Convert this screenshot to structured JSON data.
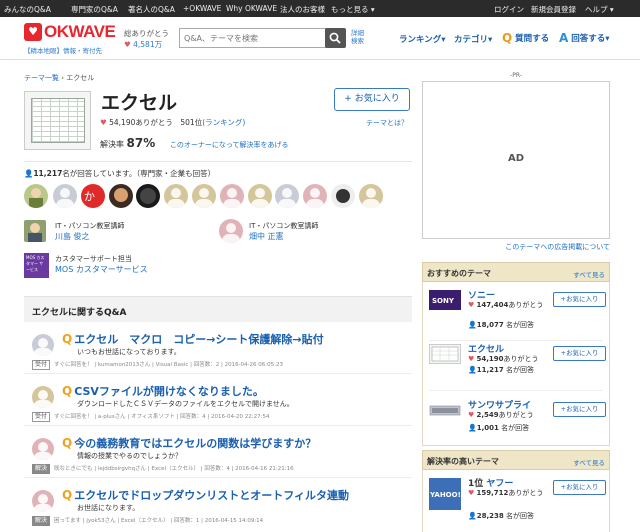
{
  "topnav": {
    "items": [
      "みんなのQ&A",
      "専門家のQ&A",
      "著名人のQ&A",
      "+OKWAVE",
      "Why OKWAVE",
      "法人のお客様",
      "もっと見る"
    ],
    "login": "ログイン",
    "register": "新規会員登録",
    "help": "ヘルプ"
  },
  "header": {
    "logo": "OKWAVE",
    "logo_sub": "【精本地眼】情報・寄付先",
    "arigatou_label": "総ありがとう",
    "arigatou_count": "4,581万",
    "search_placeholder": "Q&A、テーマを検索",
    "advanced_search": [
      "詳細",
      "検索"
    ],
    "nav": [
      "ランキング",
      "カテゴリ",
      "質問する",
      "回答する"
    ]
  },
  "breadcrumb": [
    "テーマ一覧",
    "エクセル"
  ],
  "theme": {
    "title": "エクセル",
    "thanks": "54,190ありがとう",
    "rank": "501位",
    "rank_link": "(ランキング)",
    "solve_label": "解決率",
    "solve_rate": "87",
    "solve_unit": "%",
    "owner_link": "このオーナーになって解決率をあげる",
    "fav_button": "+ お気に入り",
    "what_link": "テーマとは？",
    "answerer_count": "11,217",
    "answerer_text": "名が回答しています。（専門家・企業も回答）"
  },
  "experts": [
    {
      "role": "IT・パソコン教室講師",
      "name": "川島 俊之"
    },
    {
      "role": "IT・パソコン教室講師",
      "name": "畑中 正憲"
    },
    {
      "role": "カスタマーサポート担当",
      "name": "MOS カスタマーサービス"
    }
  ],
  "mos_logo": "MOS カスタマー サービス",
  "qa_section": {
    "title": "エクセルに関するQ&A",
    "items": [
      {
        "title": "エクセル　マクロ　コピー→シート保護解除→貼付",
        "snippet": "いつもお世話になっております。",
        "status": "受付",
        "meta": "すぐに回答を！ | kumamon2013さん | Visual Basic | 回答数：2 | 2016-04-26 06:05:23"
      },
      {
        "title": "CSVファイルが開けなくなりました。",
        "snippet": "ダウンロードしたＣＳＶデータのファイルをエクセルで開けません。",
        "status": "受付",
        "meta": "すぐに回答を！ | a-plusさん | オフィス系ソフト | 回答数：4 | 2016-04-20 22:27:54"
      },
      {
        "title": "今の義務教育ではエクセルの関数は学びますか？",
        "snippet": "情報の授業でやるのでしょうか？",
        "status": "解決",
        "meta": "既なときにでも | lejddbsirgvhqさん | Excel（エクセル） | 回答数：4 | 2016-04-16 21:21:16"
      },
      {
        "title": "エクセルでドロップダウンリストとオートフィルタ連動",
        "snippet": "お世話になります。",
        "status": "解決",
        "meta": "困ってます | jyok53さん | Excel（エクセル） | 回答数：1 | 2016-04-15 14:09:14"
      }
    ]
  },
  "sidebar": {
    "pr": "-PR-",
    "ad": "AD",
    "ad_link": "このテーマへの広告掲載について",
    "recommended": {
      "title": "おすすめのテーマ",
      "all": "すべて見る",
      "items": [
        {
          "name": "ソニー",
          "thanks": "147,404",
          "thanks_suffix": "ありがとう",
          "answerers": "18,077",
          "answerers_suffix": "名が回答",
          "fav": "+お気に入り"
        },
        {
          "name": "エクセル",
          "thanks": "54,190",
          "thanks_suffix": "ありがとう",
          "answerers": "11,217",
          "answerers_suffix": "名が回答",
          "fav": "+お気に入り"
        },
        {
          "name": "サンワサプライ",
          "thanks": "2,549",
          "thanks_suffix": "ありがとう",
          "answerers": "1,001",
          "answerers_suffix": "名が回答",
          "fav": "+お気に入り"
        }
      ]
    },
    "high_solve": {
      "title": "解決率の高いテーマ",
      "all": "すべて見る",
      "items": [
        {
          "rank": "1位",
          "name": "ヤフー",
          "thanks": "159,712",
          "thanks_suffix": "ありがとう",
          "answerers": "28,238",
          "answerers_suffix": "名が回答",
          "fav": "+お気に入り",
          "logo": "YAHOO!"
        }
      ]
    }
  },
  "colors": {
    "brand": "#e8262e",
    "link": "#1a6fc4",
    "accent_q": "#f0a21c"
  }
}
